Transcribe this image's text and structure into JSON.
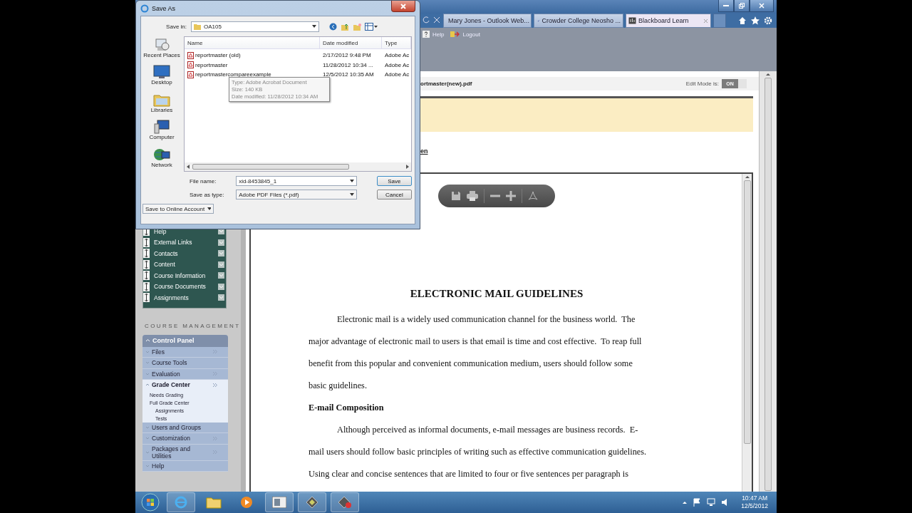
{
  "dialog": {
    "title": "Save As",
    "save_in_label": "Save in:",
    "save_in": "OA105",
    "places": [
      {
        "kind": "recent",
        "label": "Recent Places"
      },
      {
        "kind": "desktop",
        "label": "Desktop"
      },
      {
        "kind": "libraries",
        "label": "Libraries"
      },
      {
        "kind": "computer",
        "label": "Computer"
      },
      {
        "kind": "network",
        "label": "Network"
      }
    ],
    "columns": [
      "Name",
      "Date modified",
      "Type"
    ],
    "files": [
      {
        "name": "reportmaster (old)",
        "date": "2/17/2012 9:48 PM",
        "type": "Adobe Ac"
      },
      {
        "name": "reportmaster",
        "date": "11/28/2012 10:34 ...",
        "type": "Adobe Ac"
      },
      {
        "name": "reportmastercompareexample",
        "date": "12/5/2012 10:35 AM",
        "type": "Adobe Ac"
      }
    ],
    "tooltip": [
      "Type: Adobe Acrobat Document",
      "Size: 140 KB",
      "Date modified: 11/28/2012 10:34 AM"
    ],
    "file_name_label": "File name:",
    "file_name": "xid-8453845_1",
    "type_label": "Save as type:",
    "save_type": "Adobe PDF Files (*.pdf)",
    "buttons": [
      "Save",
      "Cancel"
    ],
    "online": "Save to Online Account"
  },
  "browser": {
    "tabs": [
      {
        "label": "Mary Jones - Outlook Web...",
        "selected": false,
        "kind": "mail"
      },
      {
        "label": "Crowder College Neosho ...",
        "selected": false,
        "kind": "college"
      },
      {
        "label": "Blackboard Learn",
        "selected": true,
        "kind": "blackboard"
      }
    ],
    "header_links": [
      {
        "kind": "help",
        "label": "Help"
      },
      {
        "kind": "logout",
        "label": "Logout"
      }
    ],
    "breadcrumb": "ortmaster(new).pdf",
    "edit_mode": {
      "label": "Edit Mode is:",
      "value": "ON",
      "on": true
    },
    "link": "en"
  },
  "sidebar": {
    "menu_items": [
      "Help",
      "External Links",
      "Contacts",
      "Content",
      "Course Information",
      "Course Documents",
      "Assignments"
    ],
    "section_title": "COURSE MANAGEMENT",
    "panel_title": "Control Panel",
    "panel_items": [
      {
        "label": "Files",
        "expanded": false,
        "submenu": true
      },
      {
        "label": "Course Tools",
        "expanded": false,
        "submenu": false
      },
      {
        "label": "Evaluation",
        "expanded": false,
        "submenu": true
      },
      {
        "label": "Grade Center",
        "expanded": true,
        "submenu": true,
        "children": [
          {
            "label": "Needs Grading"
          },
          {
            "label": "Full Grade Center",
            "children": [
              {
                "label": "Assignments"
              },
              {
                "label": "Tests"
              }
            ]
          }
        ]
      },
      {
        "label": "Users and Groups",
        "expanded": false,
        "submenu": false
      },
      {
        "label": "Customization",
        "expanded": false,
        "submenu": true
      },
      {
        "label": "Packages and Utilities",
        "expanded": false,
        "submenu": true
      },
      {
        "label": "Help",
        "expanded": false,
        "submenu": false
      }
    ]
  },
  "document": {
    "title": "ELECTRONIC MAIL GUIDELINES",
    "lines": [
      {
        "kind": "first",
        "text": "Electronic mail is a widely used communication channel for the business world.  The"
      },
      {
        "kind": "body",
        "text": "major advantage of electronic mail to users is that email is time and cost effective.  To reap full"
      },
      {
        "kind": "body",
        "text": "benefit from this popular and convenient communication medium, users should follow some"
      },
      {
        "kind": "body",
        "text": "basic guidelines."
      },
      {
        "kind": "heading",
        "text": "E-mail Composition"
      },
      {
        "kind": "first",
        "text": "Although perceived as informal documents, e-mail messages are business records.  E-"
      },
      {
        "kind": "body",
        "text": "mail users should follow basic principles of writing such as effective communication guidelines."
      },
      {
        "kind": "body",
        "text": "Using clear and concise sentences that are limited to four or five sentences per paragraph is"
      }
    ]
  },
  "taskbar": {
    "time": "10:47 AM",
    "date": "12/5/2012"
  }
}
